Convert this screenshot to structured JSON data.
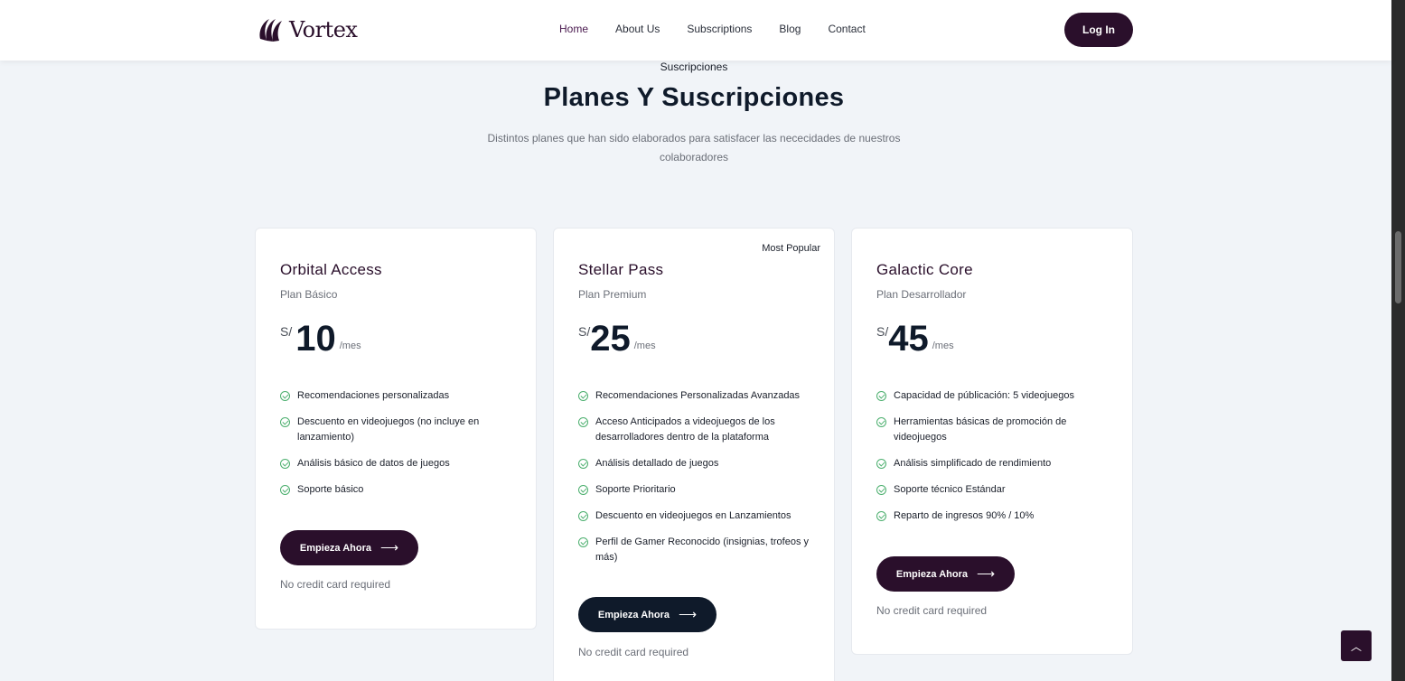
{
  "header": {
    "logo_text": "Vortex",
    "nav": [
      "Home",
      "About Us",
      "Subscriptions",
      "Blog",
      "Contact"
    ],
    "login_label": "Log In"
  },
  "section": {
    "tag": "Suscripciones",
    "title": "Planes Y Suscripciones",
    "description": "Distintos planes que han sido elaborados para satisfacer las nececidades de nuestros colaboradores"
  },
  "plans": [
    {
      "name": "Orbital Access",
      "subtitle": "Plan Básico",
      "currency": "S/",
      "amount": "10",
      "period": "/mes",
      "features": [
        "Recomendaciones personalizadas",
        "Descuento en videojuegos (no incluye en lanzamiento)",
        "Análisis básico de datos de juegos",
        "Soporte básico"
      ],
      "cta": "Empieza Ahora",
      "note": "No credit card required"
    },
    {
      "badge": "Most Popular",
      "name": "Stellar Pass",
      "subtitle": "Plan Premium",
      "currency": "S/",
      "amount": "25",
      "period": "/mes",
      "features": [
        "Recomendaciones Personalizadas Avanzadas",
        "Acceso Anticipados a videojuegos de los desarrolladores dentro de la plataforma",
        "Análisis detallado de juegos",
        "Soporte Prioritario",
        "Descuento en videojuegos en Lanzamientos",
        "Perfil de Gamer Reconocido (insignias, trofeos y más)"
      ],
      "cta": "Empieza Ahora",
      "note": "No credit card required"
    },
    {
      "name": "Galactic Core",
      "subtitle": "Plan Desarrollador",
      "currency": "S/",
      "amount": "45",
      "period": "/mes",
      "features": [
        "Capacidad de públicación: 5 videojuegos",
        "Herramientas básicas de promoción de videojuegos",
        "Análisis simplificado de rendimiento",
        "Soporte técnico Estándar",
        "Reparto de ingresos 90% / 10%"
      ],
      "cta": "Empieza Ahora",
      "note": "No credit card required"
    }
  ],
  "colors": {
    "brand": "#2a0f2b",
    "dark": "#0f1a2a",
    "check": "#4caf6e",
    "background": "#f1f4f8"
  }
}
